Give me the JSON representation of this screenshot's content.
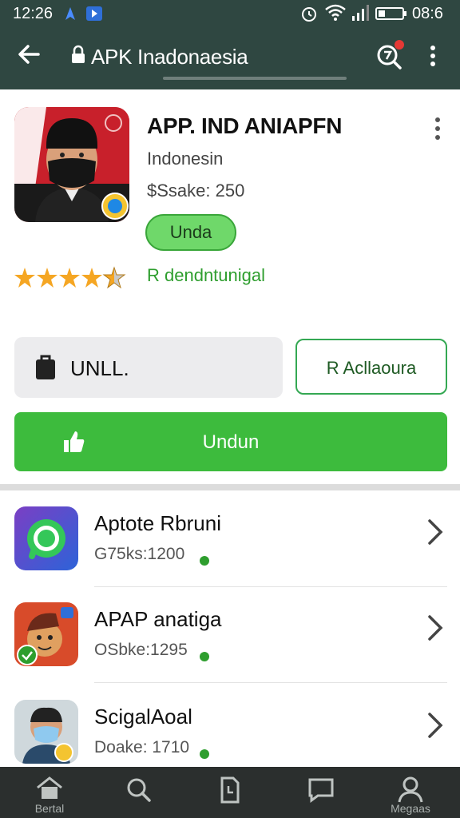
{
  "status_bar": {
    "time": "12:26",
    "clock_right": "08:6"
  },
  "app_bar": {
    "title": "APK Inadonaesia"
  },
  "app": {
    "title": "APP. IND ANIAPFN",
    "developer": "Indonesin",
    "size": "$Ssake: 250",
    "pill_label": "Unda",
    "rating_stars": 4.5,
    "rating_text": "R dendntunigal"
  },
  "actions": {
    "secondary_label": "UNLL.",
    "outline_label": "R Acllaoura",
    "primary_label": "Undun"
  },
  "list": [
    {
      "name": "Aptote Rbruni",
      "meta": "G75ks:1200"
    },
    {
      "name": "APAP anatiga",
      "meta": "OSbke:1295"
    },
    {
      "name": "ScigalAoal",
      "meta": "Doake: 1710"
    }
  ],
  "bottom_nav": {
    "items": [
      {
        "label": "Bertal",
        "icon": "home-icon"
      },
      {
        "label": "",
        "icon": "search-icon"
      },
      {
        "label": "",
        "icon": "document-icon"
      },
      {
        "label": "",
        "icon": "chat-icon"
      },
      {
        "label": "Megaas",
        "icon": "person-icon"
      }
    ]
  },
  "colors": {
    "app_bar": "#2f4741",
    "accent_green": "#3dbb3d",
    "rating_green": "#2e9e2e",
    "bottom_nav": "#2b2f2e"
  }
}
